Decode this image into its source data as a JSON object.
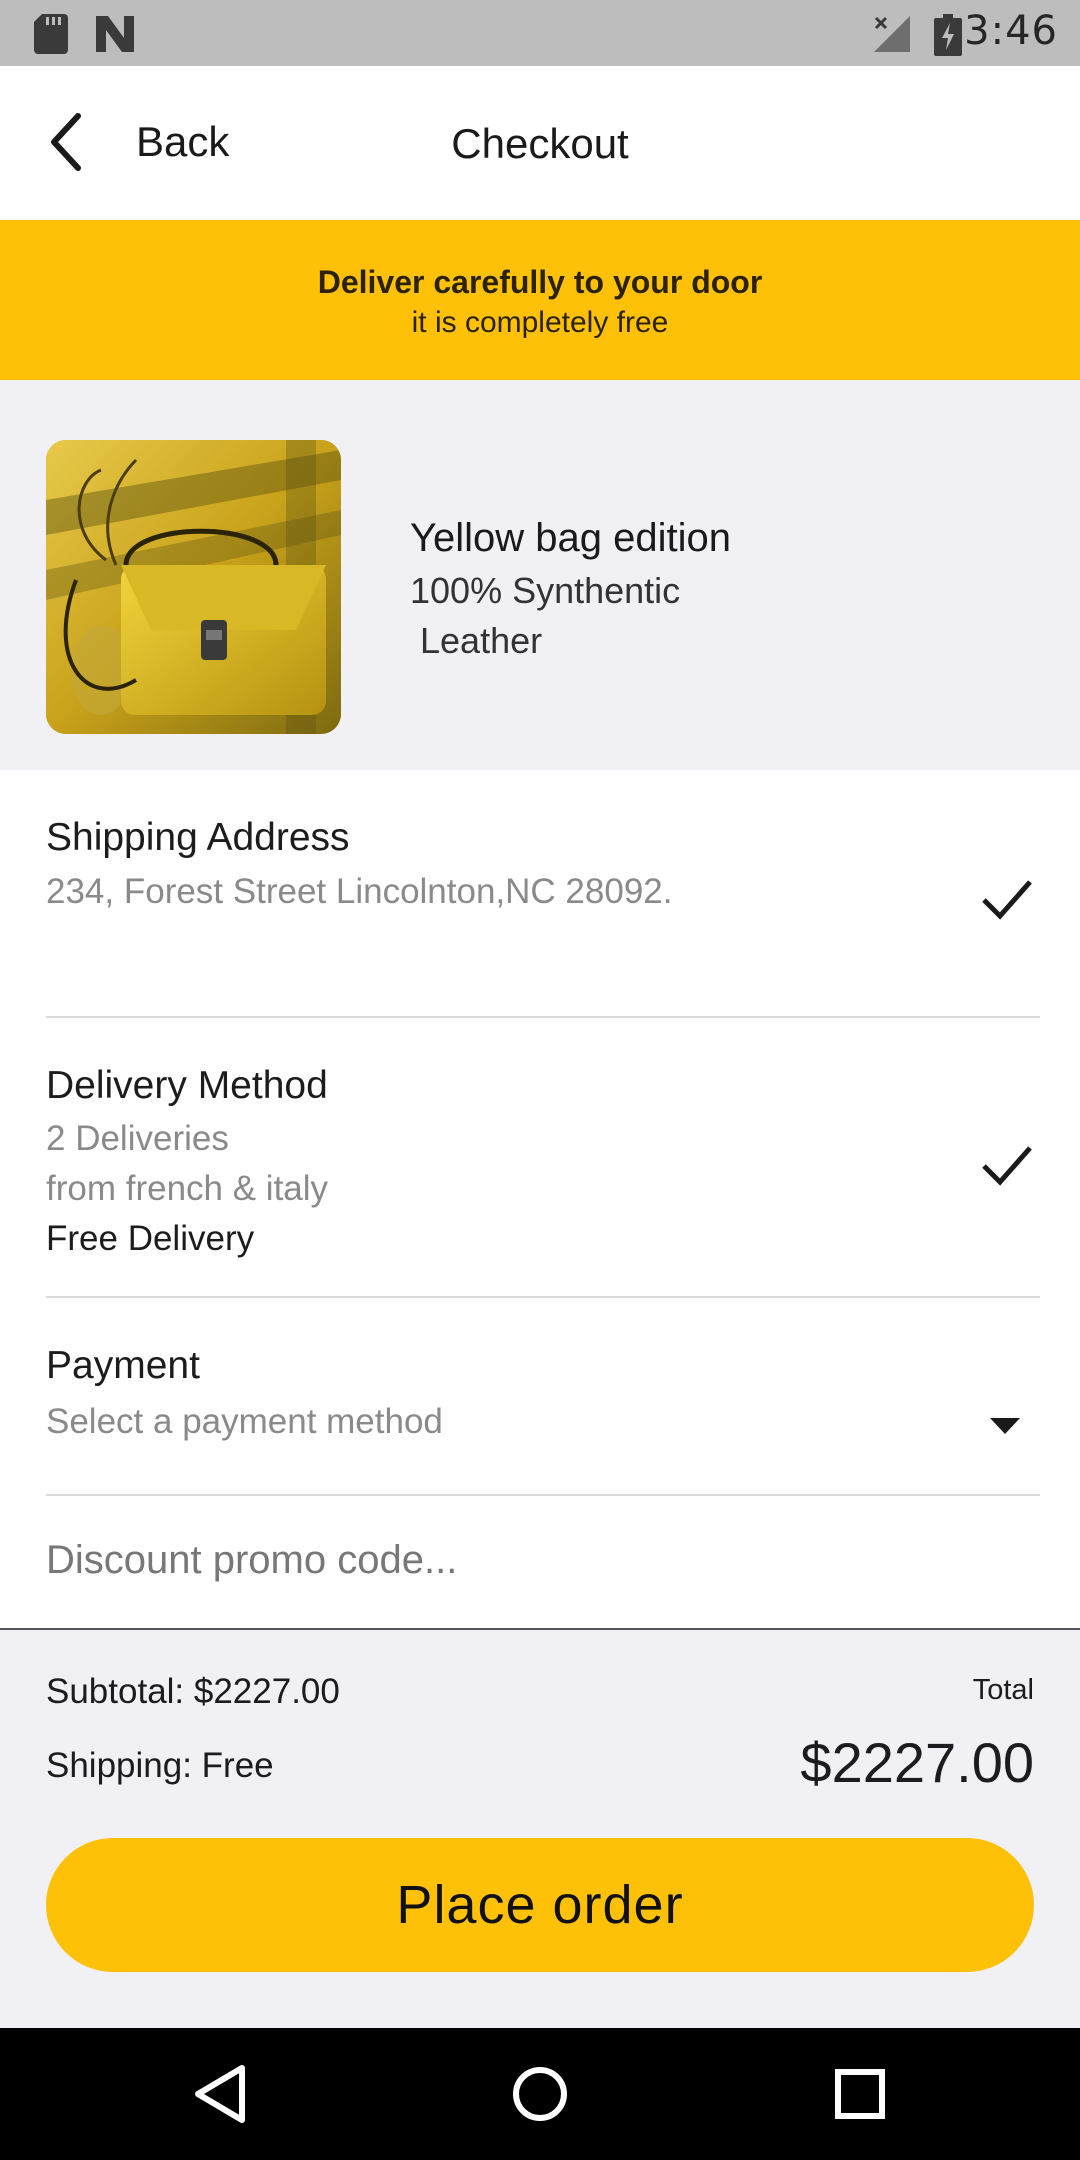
{
  "status_bar": {
    "time": "3:46",
    "icons": [
      "sd-card-icon",
      "n-logo-icon",
      "no-signal-icon",
      "battery-charging-icon"
    ]
  },
  "header": {
    "back_label": "Back",
    "title": "Checkout"
  },
  "banner": {
    "title": "Deliver carefully to your door",
    "subtitle": "it is completely free",
    "color": "#ffc107"
  },
  "product": {
    "name": "Yellow bag edition",
    "description": "100% Synthentic\n Leather"
  },
  "shipping": {
    "title": "Shipping Address",
    "address": "234, Forest Street Lincolnton,NC 28092."
  },
  "delivery": {
    "title": "Delivery Method",
    "line1": "2 Deliveries",
    "line2": "from french & italy",
    "line3": "Free Delivery"
  },
  "payment": {
    "title": "Payment",
    "placeholder": "Select a payment method"
  },
  "promo": {
    "placeholder": "Discount promo code..."
  },
  "summary": {
    "subtotal": "Subtotal: $2227.00",
    "shipping": "Shipping: Free",
    "total_label": "Total",
    "total_value": "$2227.00",
    "place_order_label": "Place order"
  },
  "nav": {
    "icons": [
      "back-triangle-icon",
      "home-circle-icon",
      "recents-square-icon"
    ]
  }
}
